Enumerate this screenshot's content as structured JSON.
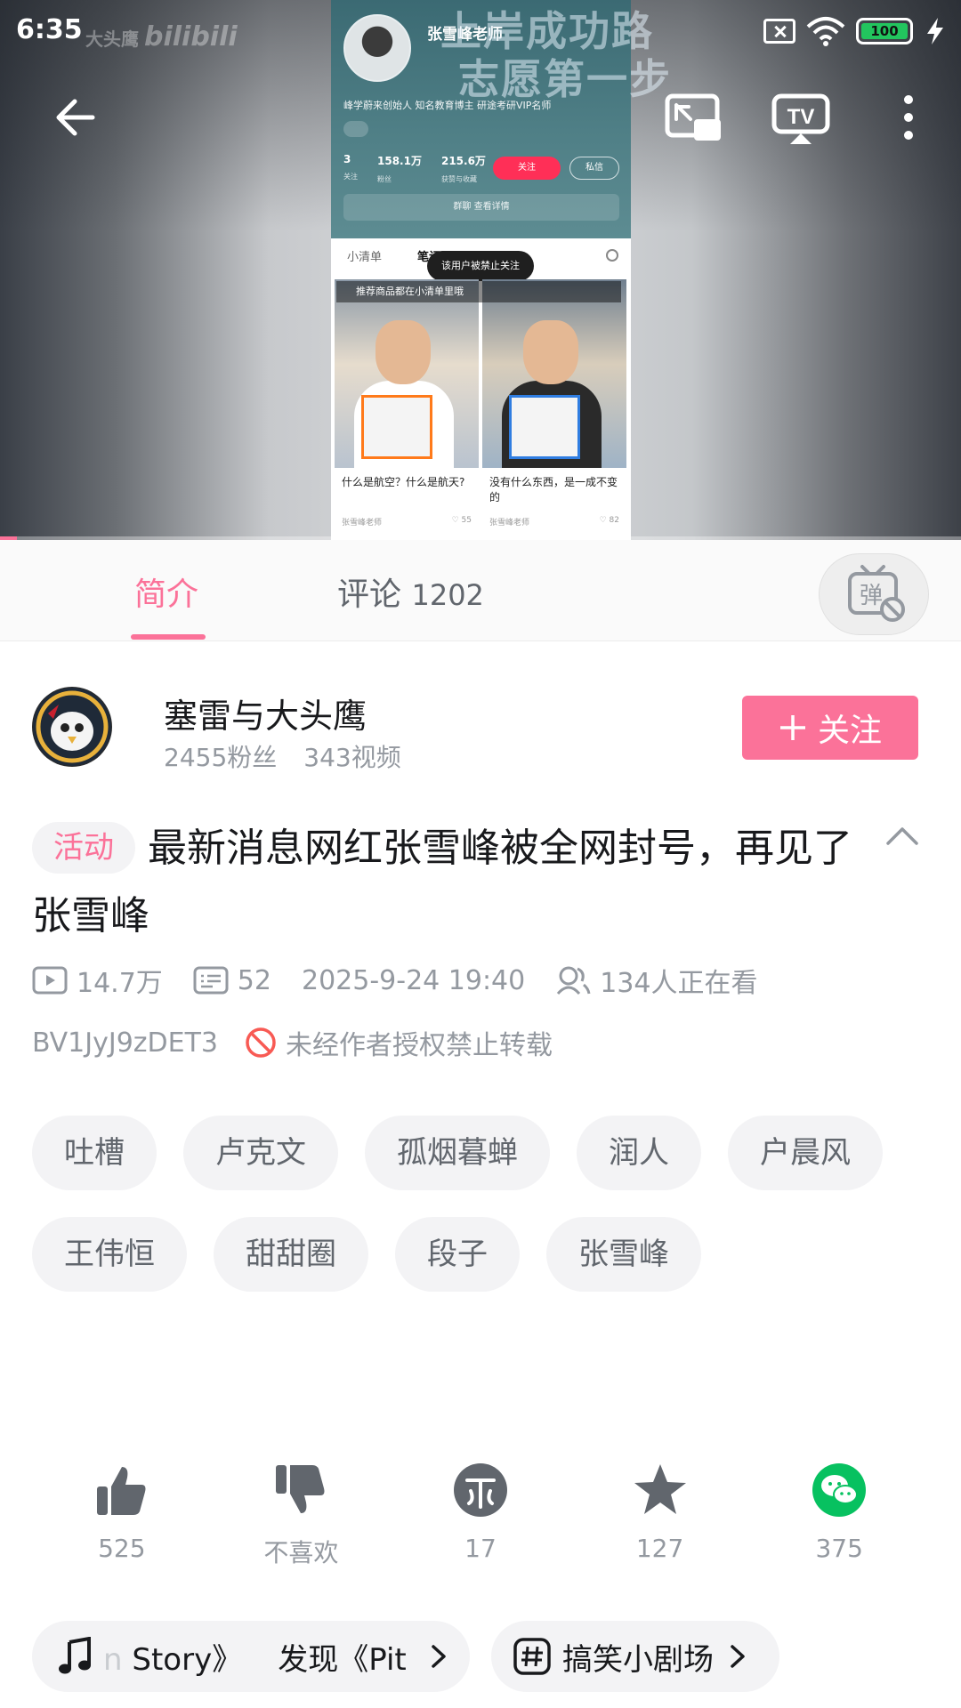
{
  "status_bar": {
    "time": "6:35",
    "battery": "100"
  },
  "video": {
    "watermark_text": "大头鹰",
    "watermark_logo": "bilibili",
    "overlay_title_line1": "上岸成功路",
    "overlay_title_line2": "志愿第一步",
    "embedded_profile": {
      "name": "张雪峰老师",
      "bio": "峰学蔚来创始人 知名教育博主 研途考研VIP名师",
      "stats": [
        {
          "value": "3",
          "label": "关注"
        },
        {
          "value": "158.1万",
          "label": "粉丝"
        },
        {
          "value": "215.6万",
          "label": "获赞与收藏"
        }
      ],
      "follow": "关注",
      "message": "私信",
      "group": "群聊 查看详情",
      "tabs": [
        "小清单",
        "笔记"
      ],
      "toast": "该用户被禁止关注",
      "banner": "推荐商品都在小清单里哦",
      "cards": [
        {
          "title": "什么是航空？什么是航天?",
          "author": "张雪峰老师",
          "likes": "55"
        },
        {
          "title": "没有什么东西，是一成不变的",
          "author": "张雪峰老师",
          "likes": "82"
        }
      ]
    },
    "progress": 0.018
  },
  "tabs": {
    "intro": "简介",
    "comments_label": "评论",
    "comments_count": "1202"
  },
  "uploader": {
    "name": "塞雷与大头鹰",
    "fans": "2455粉丝",
    "videos": "343视频",
    "follow_label": "关注"
  },
  "video_info": {
    "badge": "活动",
    "title": "最新消息网红张雪峰被全网封号，再见了张雪峰",
    "views": "14.7万",
    "danmaku": "52",
    "date": "2025-9-24 19:40",
    "watching": "134人正在看",
    "bvid": "BV1JyJ9zDET3",
    "copyright": "未经作者授权禁止转载"
  },
  "tags": [
    "吐槽",
    "卢克文",
    "孤烟暮蝉",
    "润人",
    "户晨风",
    "王伟恒",
    "甜甜圈",
    "段子",
    "张雪峰"
  ],
  "actions": {
    "like": "525",
    "dislike": "不喜欢",
    "coin": "17",
    "favorite": "127",
    "share": "375"
  },
  "chips": {
    "music_faded": "n",
    "music_text": "Story》",
    "music_text2": "发现《Pit",
    "topic": "搞笑小剧场"
  },
  "colors": {
    "accent": "#fb7299",
    "wechat": "#07c160"
  }
}
